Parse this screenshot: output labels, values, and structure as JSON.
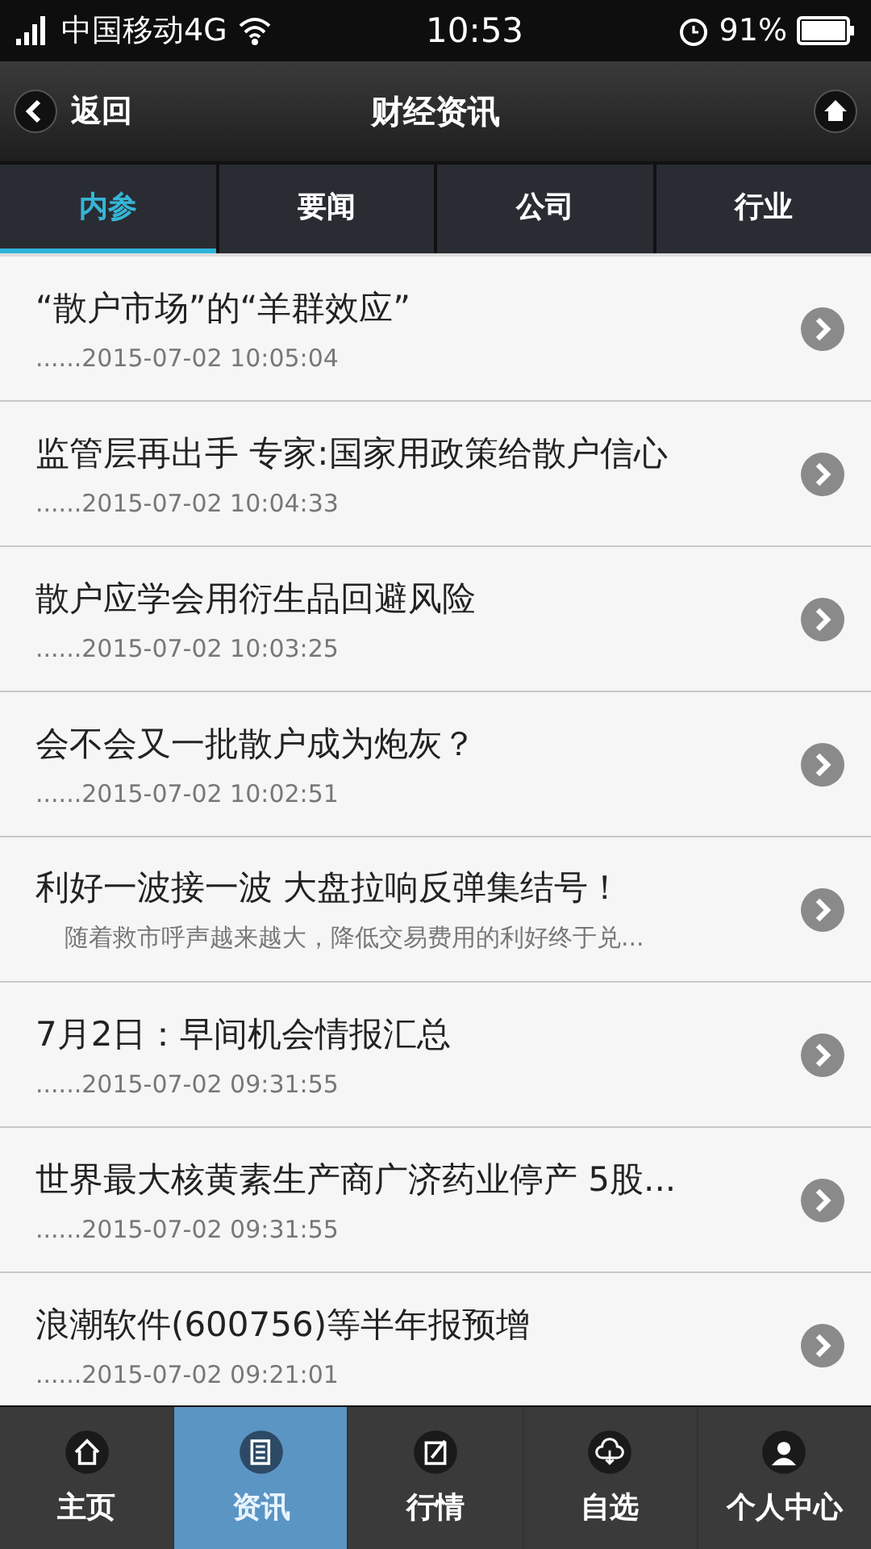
{
  "status_bar": {
    "carrier": "中国移动4G",
    "time": "10:53",
    "battery": "91%"
  },
  "header": {
    "back": "返回",
    "title": "财经资讯"
  },
  "tabs": [
    {
      "label": "内参",
      "selected": true
    },
    {
      "label": "要闻",
      "selected": false
    },
    {
      "label": "公司",
      "selected": false
    },
    {
      "label": "行业",
      "selected": false
    }
  ],
  "news": [
    {
      "title": "“散户市场”的“羊群效应”",
      "kind": "date",
      "sub": "......2015-07-02 10:05:04"
    },
    {
      "title": "监管层再出手 专家:国家用政策给散户信心",
      "kind": "date",
      "sub": "......2015-07-02 10:04:33"
    },
    {
      "title": "散户应学会用衍生品回避风险",
      "kind": "date",
      "sub": "......2015-07-02 10:03:25"
    },
    {
      "title": "会不会又一批散户成为炮灰？",
      "kind": "date",
      "sub": "......2015-07-02 10:02:51"
    },
    {
      "title": "利好一波接一波 大盘拉响反弹集结号！",
      "kind": "summary",
      "sub": "随着救市呼声越来越大，降低交易费用的利好终于兑..."
    },
    {
      "title": "7月2日：早间机会情报汇总",
      "kind": "date",
      "sub": "......2015-07-02 09:31:55"
    },
    {
      "title": "世界最大核黄素生产商广济药业停产 5股...",
      "kind": "date",
      "sub": "......2015-07-02 09:31:55"
    },
    {
      "title": "浪潮软件(600756)等半年报预增",
      "kind": "date",
      "sub": "......2015-07-02 09:21:01"
    }
  ],
  "bottom_nav": [
    {
      "label": "主页",
      "kind": "home",
      "selected": false
    },
    {
      "label": "资讯",
      "kind": "news",
      "selected": true
    },
    {
      "label": "行情",
      "kind": "edit",
      "selected": false
    },
    {
      "label": "自选",
      "kind": "cloud",
      "selected": false
    },
    {
      "label": "个人中心",
      "kind": "user",
      "selected": false
    }
  ]
}
